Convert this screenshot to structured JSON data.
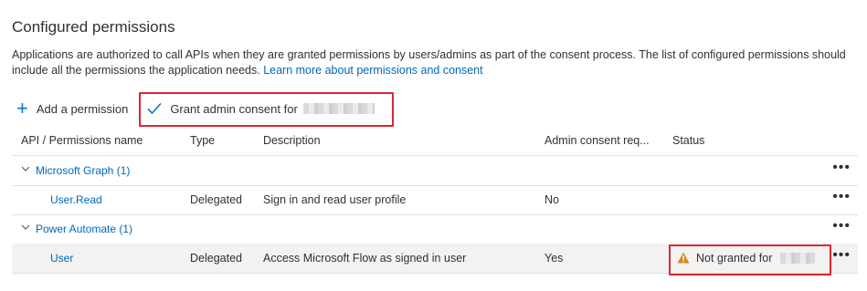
{
  "section": {
    "title": "Configured permissions",
    "description": "Applications are authorized to call APIs when they are granted permissions by users/admins as part of the consent process. The list of configured permissions should include all the permissions the application needs.",
    "learn_more": "Learn more about permissions and consent"
  },
  "toolbar": {
    "add_label": "Add a permission",
    "grant_label": "Grant admin consent for"
  },
  "table": {
    "headers": [
      "API / Permissions name",
      "Type",
      "Description",
      "Admin consent req...",
      "Status"
    ],
    "groups": [
      {
        "label": "Microsoft Graph (1)",
        "rows": [
          {
            "name": "User.Read",
            "type": "Delegated",
            "description": "Sign in and read user profile",
            "admin_consent": "No",
            "status": ""
          }
        ]
      },
      {
        "label": "Power Automate (1)",
        "rows": [
          {
            "name": "User",
            "type": "Delegated",
            "description": "Access Microsoft Flow as signed in user",
            "admin_consent": "Yes",
            "status": "Not granted for"
          }
        ]
      }
    ],
    "more_glyph": "•••"
  },
  "colors": {
    "accent": "#0078d4",
    "link": "#0067b8",
    "highlight": "#d9272e",
    "warning": "#d08a1e"
  }
}
